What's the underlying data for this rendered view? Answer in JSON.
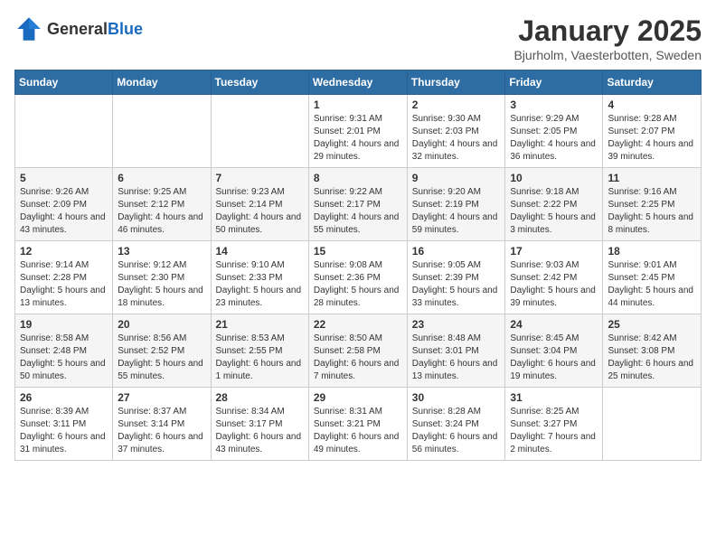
{
  "logo": {
    "general": "General",
    "blue": "Blue"
  },
  "header": {
    "title": "January 2025",
    "subtitle": "Bjurholm, Vaesterbotten, Sweden"
  },
  "days_of_week": [
    "Sunday",
    "Monday",
    "Tuesday",
    "Wednesday",
    "Thursday",
    "Friday",
    "Saturday"
  ],
  "weeks": [
    [
      {
        "day": "",
        "info": ""
      },
      {
        "day": "",
        "info": ""
      },
      {
        "day": "",
        "info": ""
      },
      {
        "day": "1",
        "info": "Sunrise: 9:31 AM\nSunset: 2:01 PM\nDaylight: 4 hours and 29 minutes."
      },
      {
        "day": "2",
        "info": "Sunrise: 9:30 AM\nSunset: 2:03 PM\nDaylight: 4 hours and 32 minutes."
      },
      {
        "day": "3",
        "info": "Sunrise: 9:29 AM\nSunset: 2:05 PM\nDaylight: 4 hours and 36 minutes."
      },
      {
        "day": "4",
        "info": "Sunrise: 9:28 AM\nSunset: 2:07 PM\nDaylight: 4 hours and 39 minutes."
      }
    ],
    [
      {
        "day": "5",
        "info": "Sunrise: 9:26 AM\nSunset: 2:09 PM\nDaylight: 4 hours and 43 minutes."
      },
      {
        "day": "6",
        "info": "Sunrise: 9:25 AM\nSunset: 2:12 PM\nDaylight: 4 hours and 46 minutes."
      },
      {
        "day": "7",
        "info": "Sunrise: 9:23 AM\nSunset: 2:14 PM\nDaylight: 4 hours and 50 minutes."
      },
      {
        "day": "8",
        "info": "Sunrise: 9:22 AM\nSunset: 2:17 PM\nDaylight: 4 hours and 55 minutes."
      },
      {
        "day": "9",
        "info": "Sunrise: 9:20 AM\nSunset: 2:19 PM\nDaylight: 4 hours and 59 minutes."
      },
      {
        "day": "10",
        "info": "Sunrise: 9:18 AM\nSunset: 2:22 PM\nDaylight: 5 hours and 3 minutes."
      },
      {
        "day": "11",
        "info": "Sunrise: 9:16 AM\nSunset: 2:25 PM\nDaylight: 5 hours and 8 minutes."
      }
    ],
    [
      {
        "day": "12",
        "info": "Sunrise: 9:14 AM\nSunset: 2:28 PM\nDaylight: 5 hours and 13 minutes."
      },
      {
        "day": "13",
        "info": "Sunrise: 9:12 AM\nSunset: 2:30 PM\nDaylight: 5 hours and 18 minutes."
      },
      {
        "day": "14",
        "info": "Sunrise: 9:10 AM\nSunset: 2:33 PM\nDaylight: 5 hours and 23 minutes."
      },
      {
        "day": "15",
        "info": "Sunrise: 9:08 AM\nSunset: 2:36 PM\nDaylight: 5 hours and 28 minutes."
      },
      {
        "day": "16",
        "info": "Sunrise: 9:05 AM\nSunset: 2:39 PM\nDaylight: 5 hours and 33 minutes."
      },
      {
        "day": "17",
        "info": "Sunrise: 9:03 AM\nSunset: 2:42 PM\nDaylight: 5 hours and 39 minutes."
      },
      {
        "day": "18",
        "info": "Sunrise: 9:01 AM\nSunset: 2:45 PM\nDaylight: 5 hours and 44 minutes."
      }
    ],
    [
      {
        "day": "19",
        "info": "Sunrise: 8:58 AM\nSunset: 2:48 PM\nDaylight: 5 hours and 50 minutes."
      },
      {
        "day": "20",
        "info": "Sunrise: 8:56 AM\nSunset: 2:52 PM\nDaylight: 5 hours and 55 minutes."
      },
      {
        "day": "21",
        "info": "Sunrise: 8:53 AM\nSunset: 2:55 PM\nDaylight: 6 hours and 1 minute."
      },
      {
        "day": "22",
        "info": "Sunrise: 8:50 AM\nSunset: 2:58 PM\nDaylight: 6 hours and 7 minutes."
      },
      {
        "day": "23",
        "info": "Sunrise: 8:48 AM\nSunset: 3:01 PM\nDaylight: 6 hours and 13 minutes."
      },
      {
        "day": "24",
        "info": "Sunrise: 8:45 AM\nSunset: 3:04 PM\nDaylight: 6 hours and 19 minutes."
      },
      {
        "day": "25",
        "info": "Sunrise: 8:42 AM\nSunset: 3:08 PM\nDaylight: 6 hours and 25 minutes."
      }
    ],
    [
      {
        "day": "26",
        "info": "Sunrise: 8:39 AM\nSunset: 3:11 PM\nDaylight: 6 hours and 31 minutes."
      },
      {
        "day": "27",
        "info": "Sunrise: 8:37 AM\nSunset: 3:14 PM\nDaylight: 6 hours and 37 minutes."
      },
      {
        "day": "28",
        "info": "Sunrise: 8:34 AM\nSunset: 3:17 PM\nDaylight: 6 hours and 43 minutes."
      },
      {
        "day": "29",
        "info": "Sunrise: 8:31 AM\nSunset: 3:21 PM\nDaylight: 6 hours and 49 minutes."
      },
      {
        "day": "30",
        "info": "Sunrise: 8:28 AM\nSunset: 3:24 PM\nDaylight: 6 hours and 56 minutes."
      },
      {
        "day": "31",
        "info": "Sunrise: 8:25 AM\nSunset: 3:27 PM\nDaylight: 7 hours and 2 minutes."
      },
      {
        "day": "",
        "info": ""
      }
    ]
  ]
}
